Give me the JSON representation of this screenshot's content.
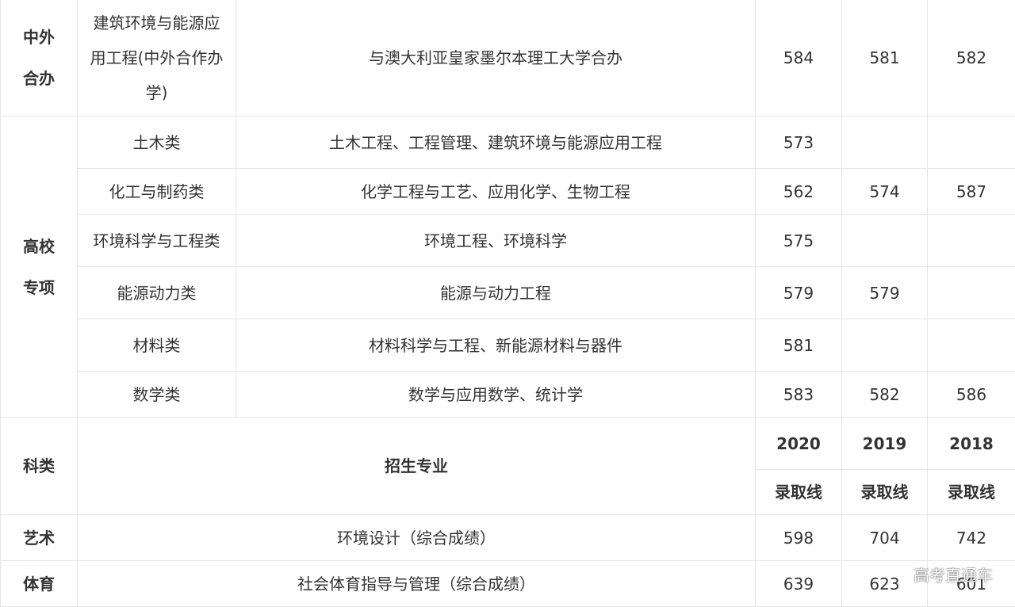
{
  "sino_foreign": {
    "category_line1": "中外",
    "category_line2": "合办",
    "major_line1": "建筑环境与能源应",
    "major_line2": "用工程(中外合作办",
    "major_line3": "学)",
    "specialties": "与澳大利亚皇家墨尔本理工大学合办",
    "score_2020": "584",
    "score_2019": "581",
    "score_2018": "582"
  },
  "special_plan": {
    "category_line1": "高校",
    "category_line2": "专项",
    "rows": [
      {
        "major": "土木类",
        "specialties": "土木工程、工程管理、建筑环境与能源应用工程",
        "score_2020": "573",
        "score_2019": "",
        "score_2018": ""
      },
      {
        "major": "化工与制药类",
        "specialties": "化学工程与工艺、应用化学、生物工程",
        "score_2020": "562",
        "score_2019": "574",
        "score_2018": "587"
      },
      {
        "major": "环境科学与工程类",
        "specialties": "环境工程、环境科学",
        "score_2020": "575",
        "score_2019": "",
        "score_2018": ""
      },
      {
        "major": "能源动力类",
        "specialties": "能源与动力工程",
        "score_2020": "579",
        "score_2019": "579",
        "score_2018": ""
      },
      {
        "major": "材料类",
        "specialties": "材料科学与工程、新能源材料与器件",
        "score_2020": "581",
        "score_2019": "",
        "score_2018": ""
      },
      {
        "major": "数学类",
        "specialties": "数学与应用数学、统计学",
        "score_2020": "583",
        "score_2019": "582",
        "score_2018": "586"
      }
    ]
  },
  "header": {
    "category": "科类",
    "specialties": "招生专业",
    "year_2020": "2020",
    "year_2019": "2019",
    "year_2018": "2018",
    "cutoff_2020": "录取线",
    "cutoff_2019": "录取线",
    "cutoff_2018": "录取线"
  },
  "art": {
    "category": "艺术",
    "specialties": "环境设计（综合成绩）",
    "score_2020": "598",
    "score_2019": "704",
    "score_2018": "742"
  },
  "sports": {
    "category": "体育",
    "specialties": "社会体育指导与管理（综合成绩）",
    "score_2020": "639",
    "score_2019": "623",
    "score_2018": "601"
  },
  "watermark": "高考直通车"
}
